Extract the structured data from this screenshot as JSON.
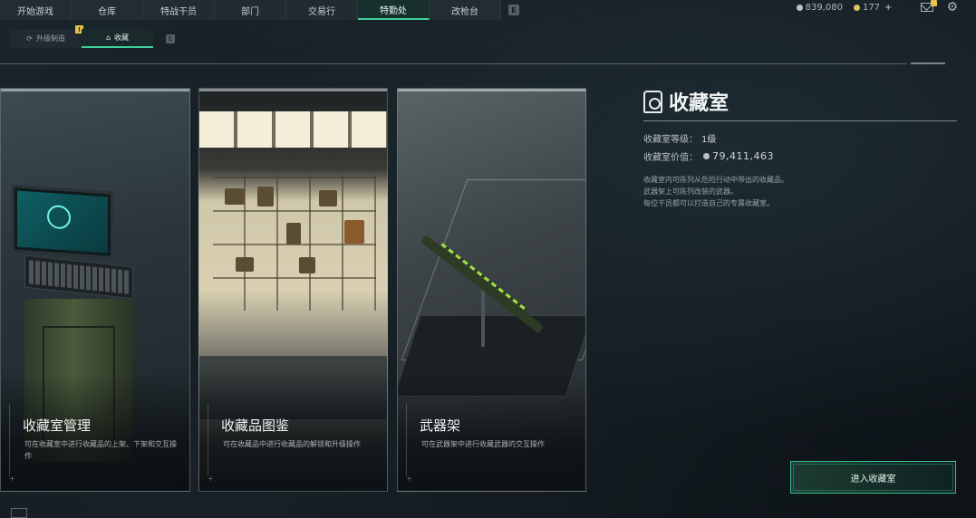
{
  "topnav": {
    "tabs": [
      "开始游戏",
      "仓库",
      "特战干员",
      "部门",
      "交易行",
      "特勤处",
      "改枪台"
    ],
    "active_index": 5,
    "hotkey": "E"
  },
  "currencies": {
    "silver": "839,080",
    "gold": "177",
    "silver_color": "#b9c2c6",
    "gold_color": "#e0c35a"
  },
  "subnav": {
    "tabs": [
      {
        "label": "升级制造",
        "icon": "gear-swap-icon",
        "warn": "!"
      },
      {
        "label": "收藏",
        "icon": "vault-icon"
      }
    ],
    "active_index": 1,
    "hotkey": "E"
  },
  "cards": [
    {
      "title": "收藏室管理",
      "desc": "可在收藏室中进行收藏品的上架、下架和交互操作"
    },
    {
      "title": "收藏品图鉴",
      "desc": "可在收藏品中进行收藏品的解锁和升级操作"
    },
    {
      "title": "武器架",
      "desc": "可在武器架中进行收藏武器的交互操作"
    }
  ],
  "vault": {
    "title": "收藏室",
    "level_label": "收藏室等级：",
    "level_value": "1级",
    "value_label": "收藏室价值：",
    "value_amount": "79,411,463",
    "desc_lines": [
      "收藏室内可陈列从危险行动中带出的收藏品。",
      "武器架上可陈列改装的武器。",
      "每位干员都可以打造自己的专属收藏室。"
    ]
  },
  "enter_button": "进入收藏室",
  "accent": "#3fd39a"
}
